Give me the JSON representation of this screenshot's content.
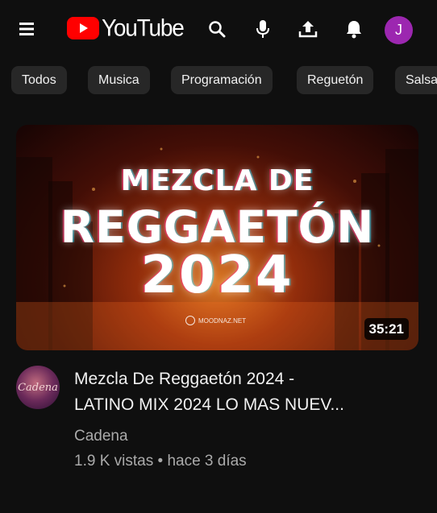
{
  "app": {
    "logo_text": "YouTube",
    "brand_red": "#ff0000",
    "background": "#0f0f0f"
  },
  "topbar": {
    "icons": [
      "menu-icon",
      "search-icon",
      "microphone-icon",
      "upload-icon",
      "notifications-icon"
    ],
    "avatar_letter": "J",
    "avatar_color": "#9c27b0"
  },
  "chips": [
    "Todos",
    "Musica",
    "Programación",
    "Reguetón",
    "Salsa"
  ],
  "video": {
    "thumbnail": {
      "line1": "MEZCLA DE",
      "line2": "REGGAETÓN",
      "line3": "2024",
      "watermark": "MOODNAZ.NET"
    },
    "duration": "35:21",
    "title_line1": "Mezcla De Reggaetón 2024 -",
    "title_line2": "LATINO MIX 2024 LO MAS NUEV...",
    "channel_avatar_text": "Cadena",
    "channel": "Cadena",
    "views": "1.9 K vistas",
    "separator": "•",
    "age": "hace 3 días"
  }
}
